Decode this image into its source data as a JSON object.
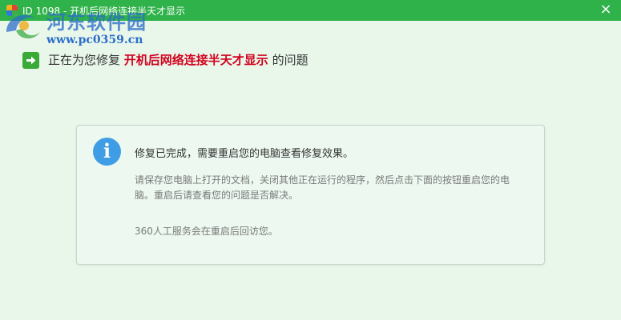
{
  "window": {
    "title": "ID 1098 - 开机后网络连接半天才显示",
    "close_glyph": "×"
  },
  "watermark": {
    "site_name": "河东软件园",
    "url": "www.pc0359.cn"
  },
  "status": {
    "prefix": "正在为您修复",
    "issue": "开机后网络连接半天才显示",
    "suffix": "的问题"
  },
  "result_panel": {
    "heading": "修复已完成，需要重启您的电脑查看修复效果。",
    "body": "请保存您电脑上打开的文档，关闭其他正在运行的程序，然后点击下面的按钮重启您的电脑。重启后请查看您的问题是否解决。",
    "note": "360人工服务会在重启后回访您。"
  },
  "colors": {
    "titlebar": "#2fb24a",
    "background": "#e9f6ea",
    "issue_highlight": "#d2001e",
    "info_icon": "#3f9de6",
    "arrow_icon": "#3aaa36"
  },
  "icons": {
    "app": "app-icon",
    "close": "close-icon",
    "arrow": "arrow-right-icon",
    "info": "info-icon",
    "watermark_logo": "watermark-logo-icon"
  }
}
